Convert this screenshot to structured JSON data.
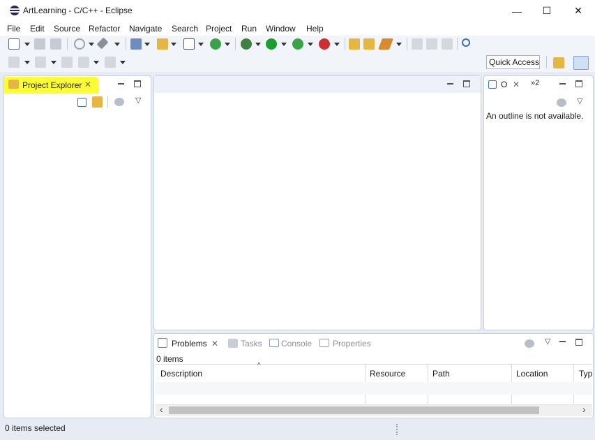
{
  "window": {
    "title": "ArtLearning - C/C++ - Eclipse",
    "minimize_glyph": "—",
    "maximize_glyph": "☐",
    "close_glyph": "✕"
  },
  "menu": [
    "File",
    "Edit",
    "Source",
    "Refactor",
    "Navigate",
    "Search",
    "Project",
    "Run",
    "Window",
    "Help"
  ],
  "toolbar": {
    "quick_access": "Quick Access"
  },
  "project_explorer": {
    "tab_label": "Project Explorer",
    "highlight_color": "#fdfd34"
  },
  "outline": {
    "tab_label": "O",
    "overflow_label": "»2",
    "message": "An outline is not available."
  },
  "bottom_panel": {
    "tabs": [
      "Problems",
      "Tasks",
      "Console",
      "Properties"
    ],
    "active_tab": "Problems",
    "count_text": "0 items",
    "columns": [
      "Description",
      "Resource",
      "Path",
      "Location",
      "Typ"
    ]
  },
  "status": {
    "text": "0 items selected"
  },
  "icons": {
    "close_tab": "✕",
    "view_menu": "▽",
    "scroll_left": "‹",
    "scroll_right": "›",
    "sort_caret": "^"
  }
}
